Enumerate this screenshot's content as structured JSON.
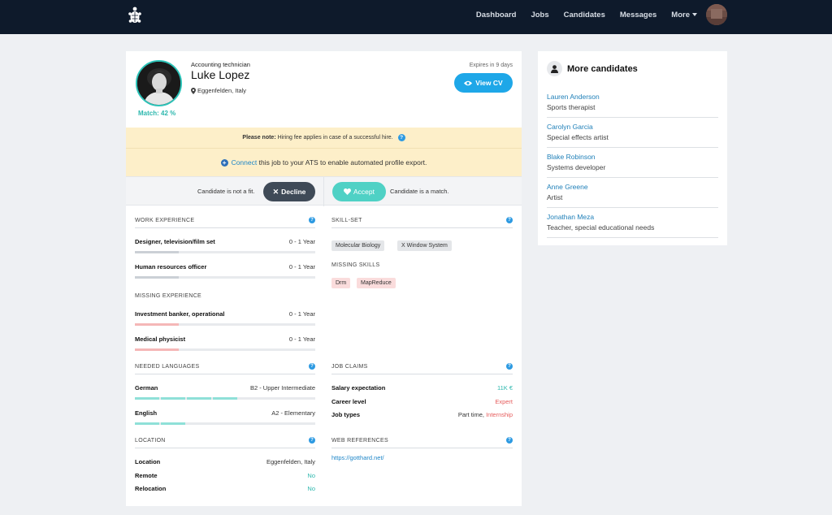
{
  "nav": {
    "links": [
      "Dashboard",
      "Jobs",
      "Candidates",
      "Messages",
      "More"
    ]
  },
  "profile": {
    "occupation": "Accounting technician",
    "name": "Luke Lopez",
    "location": "Eggenfelden, Italy",
    "match": "Match: 42 %",
    "expires": "Expires in 9 days",
    "view_cv": "View CV"
  },
  "notes": {
    "fee_bold": "Please note:",
    "fee_text": "Hiring fee applies in case of a successful hire.",
    "connect_link": "Connect",
    "connect_text": "this job to your ATS to enable automated profile export."
  },
  "decision": {
    "not_fit": "Candidate is not a fit.",
    "decline": "Decline",
    "accept": "Accept",
    "match": "Candidate is a match."
  },
  "work_experience": {
    "title": "WORK EXPERIENCE",
    "items": [
      {
        "label": "Designer, television/film set",
        "value": "0 - 1 Year",
        "level": 1
      },
      {
        "label": "Human resources officer",
        "value": "0 - 1 Year",
        "level": 1
      }
    ]
  },
  "missing_experience": {
    "title": "MISSING EXPERIENCE",
    "items": [
      {
        "label": "Investment banker, operational",
        "value": "0 - 1 Year",
        "level": 1
      },
      {
        "label": "Medical physicist",
        "value": "0 - 1 Year",
        "level": 1
      }
    ]
  },
  "skills": {
    "title": "SKILL-SET",
    "tags": [
      "Molecular Biology",
      "X Window System"
    ],
    "missing_title": "MISSING SKILLS",
    "missing_tags": [
      "Drm",
      "MapReduce"
    ]
  },
  "languages": {
    "title": "NEEDED LANGUAGES",
    "items": [
      {
        "label": "German",
        "value": "B2 - Upper Intermediate",
        "level": 4
      },
      {
        "label": "English",
        "value": "A2 - Elementary",
        "level": 2
      }
    ]
  },
  "job_claims": {
    "title": "JOB CLAIMS",
    "salary_label": "Salary expectation",
    "salary_value": "11K €",
    "career_label": "Career level",
    "career_value": "Expert",
    "types_label": "Job types",
    "types_value_a": "Part time,",
    "types_value_b": "Internship"
  },
  "location_section": {
    "title": "LOCATION",
    "location_label": "Location",
    "location_value": "Eggenfelden, Italy",
    "remote_label": "Remote",
    "remote_value": "No",
    "relocation_label": "Relocation",
    "relocation_value": "No"
  },
  "web_refs": {
    "title": "WEB REFERENCES",
    "link": "https://gotthard.net/"
  },
  "more_candidates": {
    "title": "More candidates",
    "items": [
      {
        "name": "Lauren Anderson",
        "job": "Sports therapist"
      },
      {
        "name": "Carolyn Garcia",
        "job": "Special effects artist"
      },
      {
        "name": "Blake Robinson",
        "job": "Systems developer"
      },
      {
        "name": "Anne Greene",
        "job": "Artist"
      },
      {
        "name": "Jonathan Meza",
        "job": "Teacher, special educational needs"
      }
    ]
  },
  "colors": {
    "nav_bg": "#0e1a2b",
    "accent_blue": "#1ea7e8",
    "teal": "#4fd1c5",
    "note_bg": "#fdefc9"
  }
}
